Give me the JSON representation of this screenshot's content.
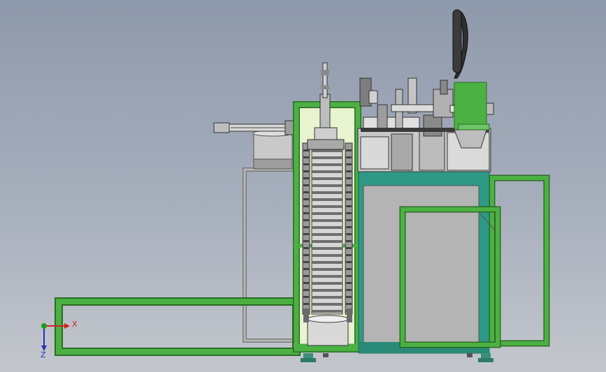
{
  "triad": {
    "x_label": "X",
    "z_label": "Z",
    "x_color": "#d42020",
    "y_color": "#1d9c22",
    "z_color": "#2230b8"
  },
  "colors": {
    "background_top": "#8e99ab",
    "background_bottom": "#c3c6cc",
    "frame_green": "#3fa63a",
    "cabinet_teal": "#2e9a86",
    "panel_gray": "#b4b4b4",
    "metal": "#c8c8c8",
    "dark_metal": "#3a3a3a"
  }
}
